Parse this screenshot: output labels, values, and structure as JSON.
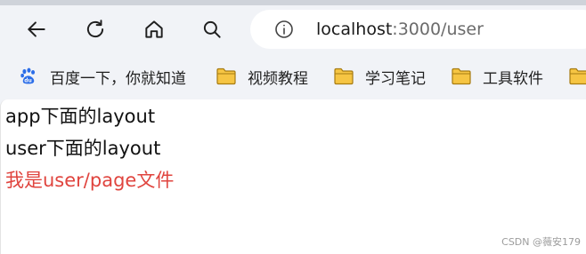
{
  "toolbar": {
    "back_icon": "arrow-left-icon",
    "reload_icon": "reload-icon",
    "home_icon": "home-icon",
    "search_icon": "search-icon"
  },
  "address_bar": {
    "info_icon": "info-icon",
    "host": "localhost",
    "rest": ":3000/user"
  },
  "bookmarks": [
    {
      "label": "百度一下，你就知道",
      "icon": "baidu-paw-icon"
    },
    {
      "label": "视频教程",
      "icon": "folder-icon"
    },
    {
      "label": "学习笔记",
      "icon": "folder-icon"
    },
    {
      "label": "工具软件",
      "icon": "folder-icon"
    }
  ],
  "page": {
    "line1": "app下面的layout",
    "line2": "user下面的layout",
    "line3": "我是user/page文件",
    "line3_color": "#e0443e"
  },
  "watermark": "CSDN @薇安179"
}
